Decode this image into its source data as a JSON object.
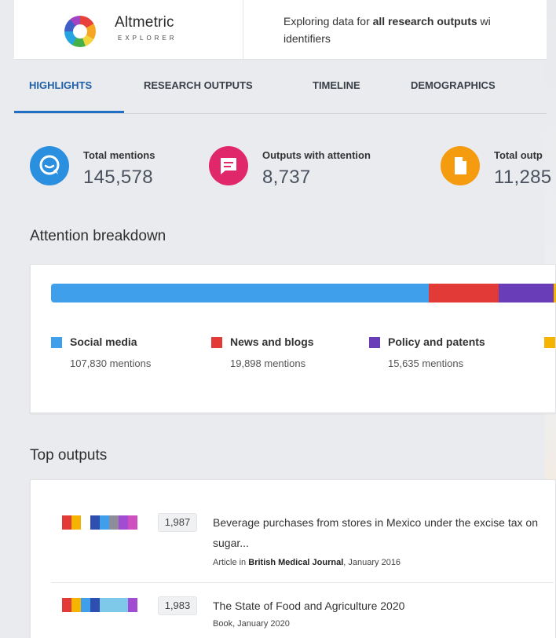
{
  "header": {
    "logo_name": "Altmetric",
    "logo_sub": "EXPLORER",
    "desc_prefix": "Exploring data for ",
    "desc_bold": "all research outputs",
    "desc_suffix": " wi",
    "desc_line2": "identifiers"
  },
  "tabs": [
    {
      "label": "HIGHLIGHTS",
      "active": true
    },
    {
      "label": "RESEARCH OUTPUTS",
      "active": false
    },
    {
      "label": "TIMELINE",
      "active": false
    },
    {
      "label": "DEMOGRAPHICS",
      "active": false
    }
  ],
  "stats": [
    {
      "label": "Total mentions",
      "value": "145,578",
      "icon": "chat-bubble-icon",
      "color": "#2b8fe0"
    },
    {
      "label": "Outputs with attention",
      "value": "8,737",
      "icon": "message-icon",
      "color": "#e0276a"
    },
    {
      "label": "Total outp",
      "value": "11,285",
      "icon": "document-icon",
      "color": "#f59b0f"
    }
  ],
  "attention": {
    "title": "Attention breakdown",
    "segments": [
      {
        "label": "Social media",
        "count": "107,830 mentions",
        "mentions": 107830,
        "color": "#3f9fea"
      },
      {
        "label": "News and blogs",
        "count": "19,898 mentions",
        "mentions": 19898,
        "color": "#e23a36"
      },
      {
        "label": "Policy and patents",
        "count": "15,635 mentions",
        "mentions": 15635,
        "color": "#6a3db8"
      },
      {
        "label": "",
        "count": "",
        "mentions": 2215,
        "color": "#f4b400"
      }
    ]
  },
  "top_outputs": {
    "title": "Top outputs",
    "items": [
      {
        "score": "1,987",
        "title": "Beverage purchases from stores in Mexico under the excise tax on sugar...",
        "meta_prefix": "Article in ",
        "meta_bold": "British Medical Journal",
        "meta_suffix": ", January 2016",
        "donut_colors": [
          "#e23a36",
          "#f4b400",
          "#ffffff",
          "#2f4fb0",
          "#3f9fea",
          "#8e8e9a",
          "#a24bd3",
          "#d04fc0"
        ]
      },
      {
        "score": "1,983",
        "title": "The State of Food and Agriculture 2020",
        "meta_prefix": "Book, January 2020",
        "meta_bold": "",
        "meta_suffix": "",
        "donut_colors": [
          "#e23a36",
          "#f4b400",
          "#3f9fea",
          "#2f4fb0",
          "#7ec8ea",
          "#7ec8ea",
          "#7ec8ea",
          "#a24bd3"
        ]
      }
    ]
  }
}
